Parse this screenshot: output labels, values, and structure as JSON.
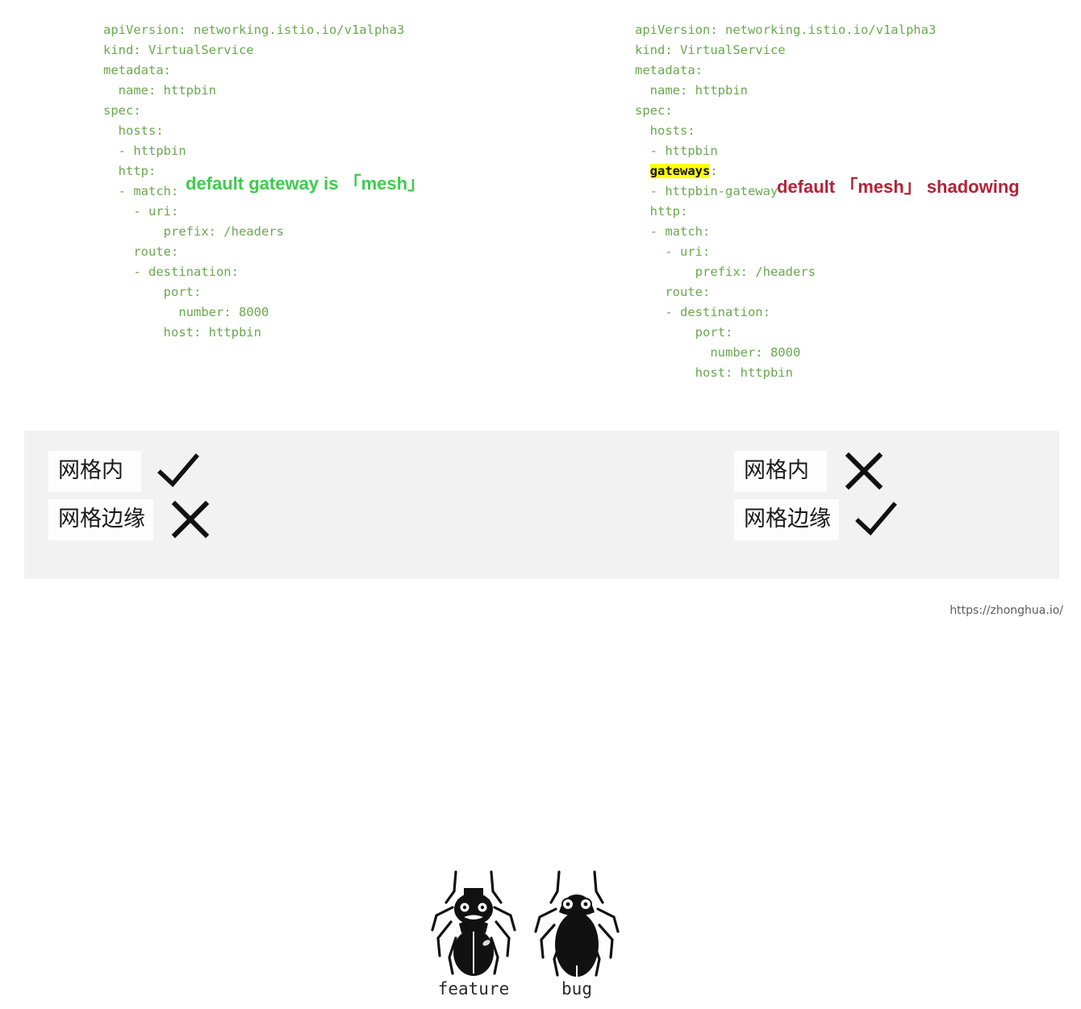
{
  "slide": {
    "background_color": "#ffffff",
    "code_color": "#6aa84f",
    "highlight_color": "#ffff00",
    "green_accent": "#3dcc4c",
    "red_accent": "#b42236",
    "panel_color": "#f2f2f2"
  },
  "code_left": {
    "title": "VirtualService without gateways",
    "lines": [
      "apiVersion: networking.istio.io/v1alpha3",
      "kind: VirtualService",
      "metadata:",
      "  name: httpbin",
      "spec:",
      "  hosts:",
      "  - httpbin",
      "  http:",
      "  - match:",
      "    - uri:",
      "        prefix: /headers",
      "    route:",
      "    - destination:",
      "        port:",
      "          number: 8000",
      "        host: httpbin"
    ]
  },
  "code_right": {
    "title": "VirtualService with gateways",
    "lines_before": [
      "apiVersion: networking.istio.io/v1alpha3",
      "kind: VirtualService",
      "metadata:",
      "  name: httpbin",
      "spec:",
      "  hosts:",
      "  - httpbin"
    ],
    "highlighted_line": {
      "indent": "  ",
      "highlighted_text": "gateways",
      "suffix": ":"
    },
    "lines_after": [
      "  - httpbin-gateway",
      "  http:",
      "  - match:",
      "    - uri:",
      "        prefix: /headers",
      "    route:",
      "    - destination:",
      "        port:",
      "          number: 8000",
      "        host: httpbin"
    ]
  },
  "annotations": {
    "left": "default gateway is 「mesh」",
    "right": "default 「mesh」 shadowing"
  },
  "compare": {
    "left": {
      "rows": [
        {
          "label": "网格内",
          "mark": "check-icon"
        },
        {
          "label": "网格边缘",
          "mark": "cross-icon"
        }
      ]
    },
    "right": {
      "rows": [
        {
          "label": "网格内",
          "mark": "cross-icon"
        },
        {
          "label": "网格边缘",
          "mark": "check-icon"
        }
      ]
    }
  },
  "bugs": [
    {
      "caption": "feature",
      "icon": "beetle-with-hat-icon"
    },
    {
      "caption": "bug",
      "icon": "beetle-icon"
    }
  ],
  "footer": {
    "url": "https://zhonghua.io/"
  }
}
